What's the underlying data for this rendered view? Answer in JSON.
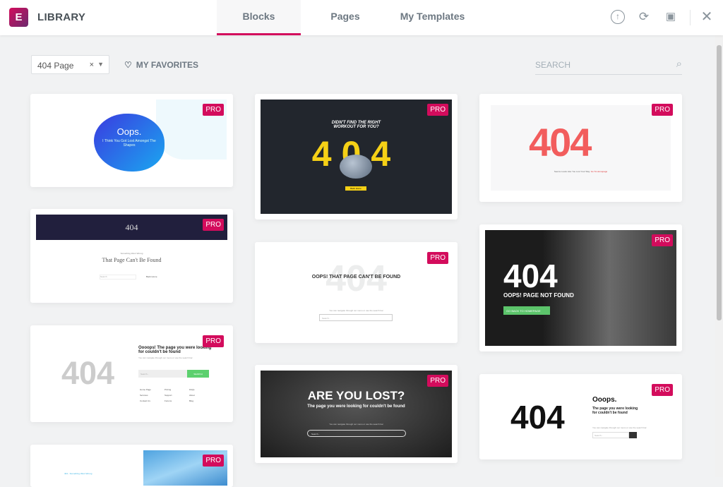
{
  "header": {
    "title": "LIBRARY",
    "logo": "E",
    "tabs": [
      {
        "label": "Blocks",
        "active": true
      },
      {
        "label": "Pages"
      },
      {
        "label": "My Templates"
      }
    ],
    "icons": [
      "upload-icon",
      "sync-icon",
      "save-icon",
      "close-icon"
    ]
  },
  "toolbar": {
    "filter_value": "404 Page",
    "clear": "×",
    "favorites": "MY FAVORITES",
    "search_placeholder": "SEARCH"
  },
  "badge": "PRO",
  "accent": "#d30c5c",
  "cards": {
    "c1": {
      "title": "Oops.",
      "sub": "I Think You Got Lost Amongst The Shapes"
    },
    "c2": {
      "banner": "404",
      "kicker": "Something Went Wrong",
      "title": "That Page Can't Be Found",
      "search": "Search",
      "link": "Back Home"
    },
    "c3": {
      "big": "404",
      "title": "Oooops! The page you were looking for couldn't be found",
      "sub": "You can navigate through our menu or use the search bar",
      "search": "Search...",
      "button": "SEARCH",
      "links": [
        "Home Page",
        "Pricing",
        "FAQs",
        "Services",
        "Support",
        "About",
        "Contact Us",
        "Forums",
        "Blog"
      ]
    },
    "c4": {
      "caption": "404 - Something Went Wrong"
    },
    "c5": {
      "title": "DIDN'T FIND THE RIGHT WORKOUT FOR YOU?",
      "big": "404",
      "button": "Back Home"
    },
    "c6": {
      "big": "404",
      "title": "OOPS! THAT PAGE CAN'T BE FOUND",
      "sub": "You can navigate through our menu or use the search bar",
      "search": "Search..."
    },
    "c7": {
      "title": "ARE YOU LOST?",
      "sub": "The page you were looking for couldn't be found",
      "small": "You can navigate through our menu or use the search bar",
      "search": "Search..."
    },
    "c8": {
      "big": "404",
      "sub": "Seems Looks Like You Lost Your Way.",
      "link": "Go To Homepage"
    },
    "c9": {
      "big": "404",
      "title": "OOPS! PAGE NOT FOUND",
      "button": "GO BACK TO HOMEPAGE"
    },
    "c10": {
      "big": "404",
      "title": "Ooops.",
      "sub": "The page you were looking for couldn't be found",
      "small": "You can navigate through our menu or use the search bar",
      "search": "Search..."
    }
  }
}
